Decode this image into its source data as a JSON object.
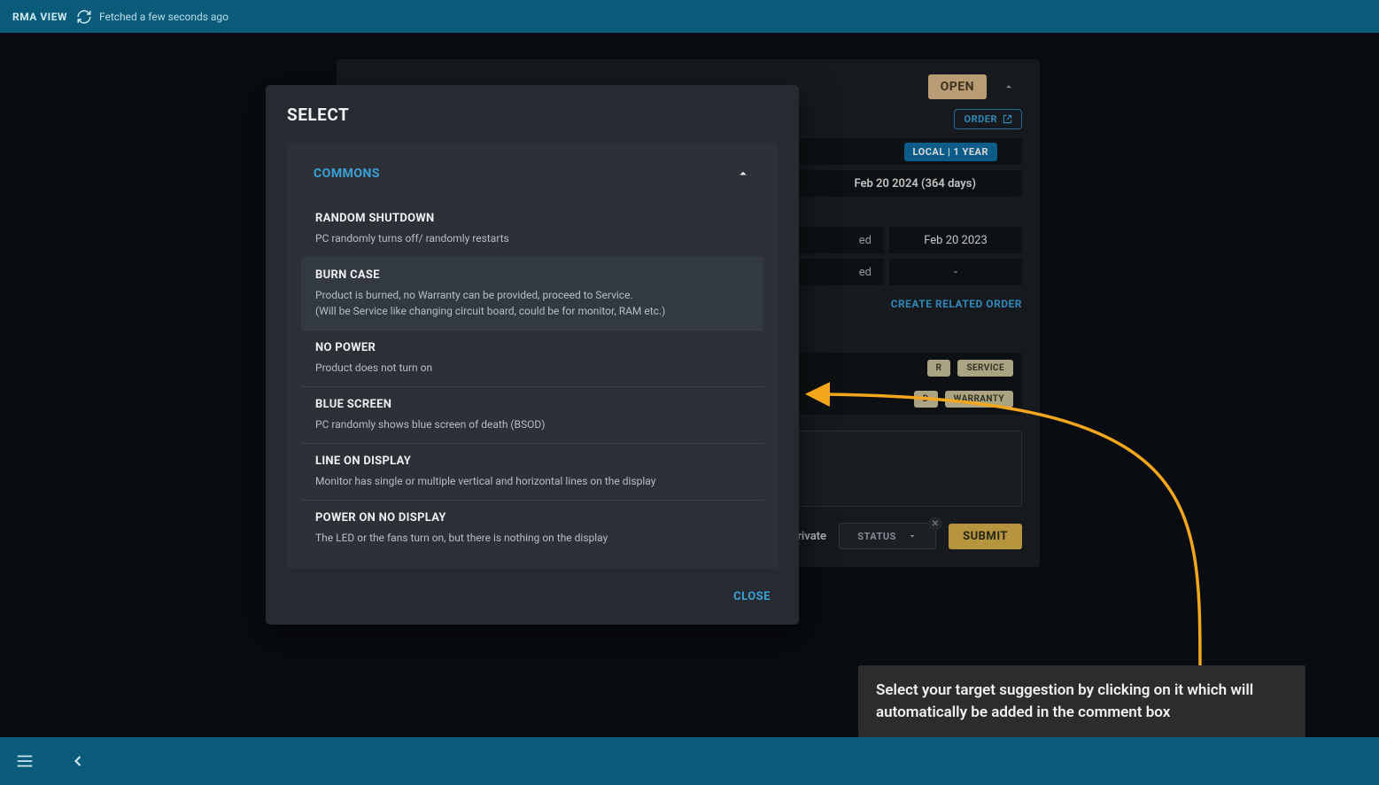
{
  "topbar": {
    "title": "RMA VIEW",
    "fetched": "Fetched a few seconds ago"
  },
  "card": {
    "statusOpen": "OPEN",
    "orderChip": "ORDER",
    "warrantyTag": "LOCAL | 1 YEAR",
    "expiryDate": "Feb 20 2024 (364 days)",
    "receivedLabel": "ed",
    "receivedValue": "Feb 20 2023",
    "completedLabel": "ed",
    "completedValue": "-",
    "createOrder": "CREATE RELATED ORDER",
    "chipR": "R",
    "chipService": "SERVICE",
    "chipD": "D",
    "chipWarranty": "WARRANTY",
    "privateLabel": "Private",
    "statusDd": "STATUS",
    "submit": "SUBMIT"
  },
  "modal": {
    "title": "SELECT",
    "accTitle": "COMMONS",
    "items": [
      {
        "title": "RANDOM SHUTDOWN",
        "desc": "PC randomly turns off/ randomly restarts"
      },
      {
        "title": "BURN CASE",
        "desc": "Product is burned, no Warranty can be provided, proceed to Service.\n(Will be Service like changing circuit board, could be for monitor, RAM etc.)"
      },
      {
        "title": "NO POWER",
        "desc": "Product does not turn on"
      },
      {
        "title": "BLUE SCREEN",
        "desc": "PC randomly shows blue screen of death (BSOD)"
      },
      {
        "title": "LINE ON DISPLAY",
        "desc": "Monitor has single or multiple vertical and horizontal lines on the display"
      },
      {
        "title": "POWER ON NO DISPLAY",
        "desc": "The LED or the fans turn on, but there is nothing on the display"
      }
    ],
    "close": "CLOSE"
  },
  "tooltip": "Select your target suggestion by clicking on it which will automatically be added in the comment box"
}
